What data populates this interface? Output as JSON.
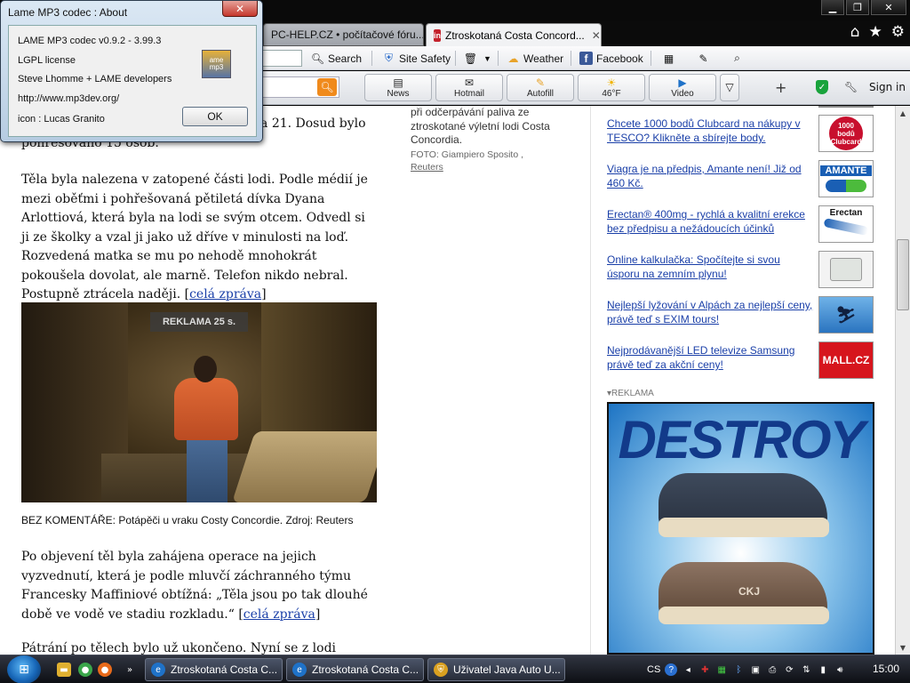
{
  "window": {
    "minimize_icon": "minimize-icon",
    "maximize_icon": "maximize-icon",
    "close_icon": "close-icon"
  },
  "tabs": [
    {
      "label": "PC-HELP.CZ • počítačové fóru...",
      "active": false
    },
    {
      "label": "Ztroskotaná Costa Concord...",
      "active": true,
      "favicon": "in",
      "close": "✕"
    }
  ],
  "chrome_icons": [
    "home-icon",
    "favorites-star-icon",
    "settings-gear-icon"
  ],
  "toolbar1": {
    "search": "Search",
    "site_safety": "Site Safety",
    "weather": "Weather",
    "facebook": "Facebook"
  },
  "toolbar2": {
    "buttons": [
      {
        "label": "News",
        "icon": "news-icon"
      },
      {
        "label": "Hotmail",
        "icon": "mail-icon"
      },
      {
        "label": "Autofill",
        "icon": "autofill-icon"
      },
      {
        "label": "46°F",
        "icon": "sun-icon"
      },
      {
        "label": "Video",
        "icon": "play-icon"
      }
    ],
    "plus": "+",
    "sign_in": "Sign in"
  },
  "dialog": {
    "title": "Lame MP3 codec : About",
    "close": "✕",
    "lines": [
      "LAME MP3 codec v0.9.2 - 3.99.3",
      "LGPL license",
      "Steve Lhomme + LAME developers",
      "http://www.mp3dev.org/",
      "icon : Lucas Granito"
    ],
    "icon_text": "ame\nmp3",
    "ok": "OK"
  },
  "article": {
    "p0_partial": "na 21. Dosud bylo",
    "p0_line2": "pohřešováno 15 osob.",
    "p1": "Těla byla nalezena v zatopené části lodi. Podle médií je mezi oběťmi i pohřešovaná pětiletá dívka Dyana Arlottiová, která byla na lodi se svým otcem. Odvedl si ji ze školky a vzal ji jako už dříve v minulosti na loď. Rozvedená matka se mu po nehodě mnohokrát pokoušela dovolat, ale marně. Telefon nikdo nebral. Postupně ztrácela naději.",
    "link_full": "celá zpráva",
    "video_ad_badge": "REKLAMA 25 s.",
    "caption": "BEZ KOMENTÁŘE: Potápěči u vraku Costy Concordie. Zdroj: Reuters",
    "p2": "Po objevení těl byla zahájena operace na jejich vyzvednutí, která je podle mluvčí záchranného týmu Francesky Maffiniové obtížná: „Těla jsou po tak dlouhé době ve vodě ve stadiu rozkladu.“",
    "p3": "Pátrání po tělech bylo už ukončeno. Nyní se z lodi"
  },
  "photo": {
    "caption": "při odčerpávání paliva ze ztroskotané výletní lodi Costa Concordia.",
    "credit": "FOTO: Giampiero Sposito ,",
    "credit_source": "Reuters"
  },
  "sidebar_ads": [
    {
      "text": "Chcete 1000 bodů Clubcard na nákupy v TESCO? Klikněte a sbírejte body.",
      "thumb": "1000 bodů Clubcard"
    },
    {
      "text": "Viagra je na předpis, Amante není! Již od 460 Kč.",
      "thumb": "AMANTE"
    },
    {
      "text": "Erectan® 400mg - rychlá a kvalitní erekce bez předpisu a nežádoucích účinků",
      "thumb": "Erectan"
    },
    {
      "text": "Online kalkulačka: Spočítejte si svou úsporu na zemním plynu!",
      "thumb": ""
    },
    {
      "text": "Nejlepší lyžování v Alpách za nejlepší ceny, právě teď s EXIM tours!",
      "thumb": ""
    },
    {
      "text": "Nejprodávanější LED televize Samsung právě teď za akční ceny!",
      "thumb": "MALL.CZ"
    }
  ],
  "reklama_label": "▾REKLAMA",
  "big_ad": {
    "brand": "DESTROY",
    "shoe_text": "CKJ"
  },
  "taskbar": {
    "start_icon": "windows-start-icon",
    "show_more": "»",
    "tasks": [
      {
        "label": "Ztroskotaná Costa C...",
        "icon": "ie-icon"
      },
      {
        "label": "Ztroskotaná Costa C...",
        "icon": "ie-icon"
      },
      {
        "label": "Uživatel Java Auto U...",
        "icon": "shield-icon"
      }
    ],
    "lang": "CS",
    "clock": "15:00"
  }
}
